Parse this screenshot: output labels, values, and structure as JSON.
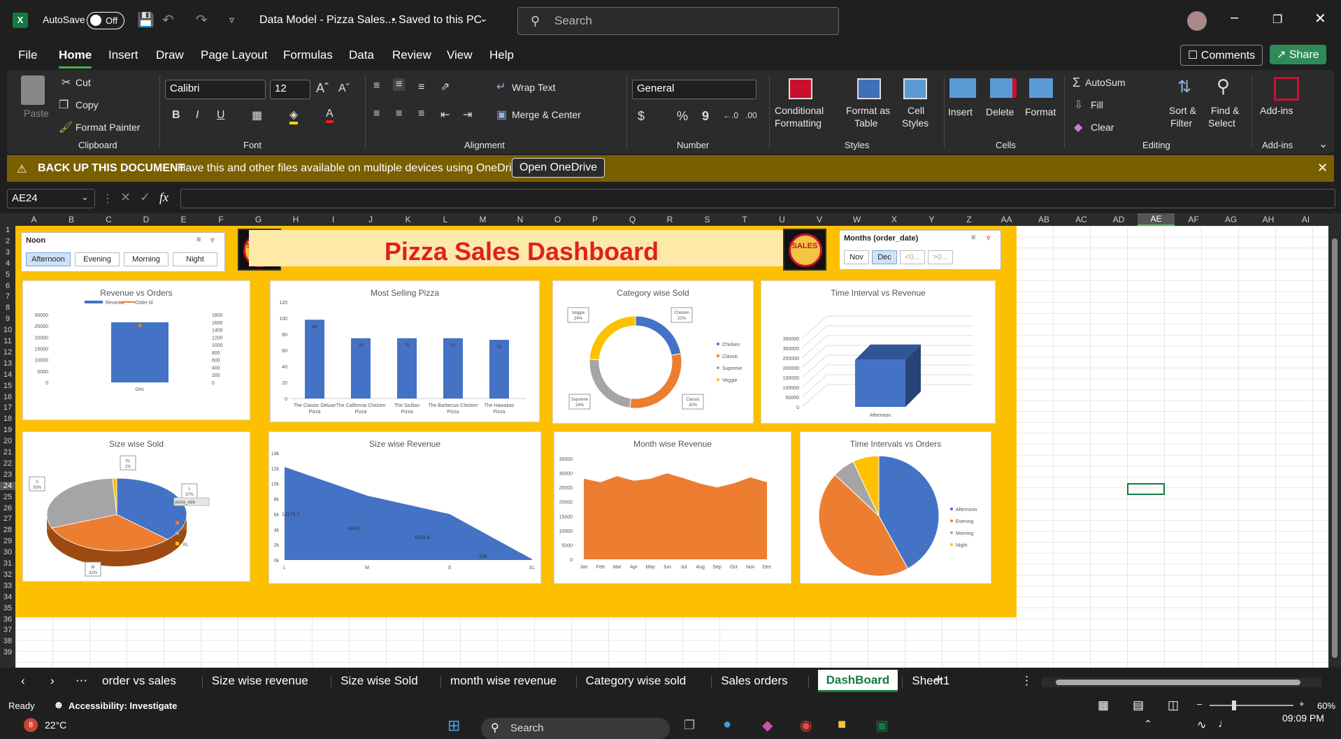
{
  "app": {
    "logo": "X",
    "autosave_label": "AutoSave",
    "toggle": "Off",
    "doc_title": "Data Model - Pizza Sales....",
    "saved": "• Saved to this PC",
    "search_placeholder": "Search"
  },
  "menu": [
    "File",
    "Home",
    "Insert",
    "Draw",
    "Page Layout",
    "Formulas",
    "Data",
    "Review",
    "View",
    "Help"
  ],
  "menu_right": {
    "comments": "Comments",
    "share": "Share"
  },
  "ribbon": {
    "clipboard": {
      "paste": "Paste",
      "cut": "Cut",
      "copy": "Copy",
      "format_painter": "Format Painter",
      "label": "Clipboard"
    },
    "font": {
      "name": "Calibri",
      "size": "12",
      "bold": "B",
      "italic": "I",
      "underline": "U",
      "label": "Font"
    },
    "alignment": {
      "wrap": "Wrap Text",
      "merge": "Merge & Center",
      "label": "Alignment"
    },
    "number": {
      "format": "General",
      "currency": "$",
      "percent": "%",
      "comma": "9",
      "label": "Number"
    },
    "styles": {
      "conditional": "Conditional",
      "conditional2": "Formatting",
      "format_table": "Format as",
      "format_table2": "Table",
      "cell_styles": "Cell",
      "cell_styles2": "Styles",
      "label": "Styles"
    },
    "cells": {
      "insert": "Insert",
      "delete": "Delete",
      "format": "Format",
      "label": "Cells"
    },
    "editing": {
      "autosum": "AutoSum",
      "fill": "Fill",
      "clear": "Clear",
      "sort": "Sort &",
      "sort2": "Filter",
      "find": "Find &",
      "find2": "Select",
      "label": "Editing"
    },
    "addins": {
      "addins": "Add-ins",
      "label": "Add-ins"
    }
  },
  "notification": {
    "title": "BACK UP THIS DOCUMENT",
    "text": "Have this and other files available on multiple devices using OneDrive.",
    "button": "Open OneDrive"
  },
  "formula_bar": {
    "name_box": "AE24",
    "fx": "fx"
  },
  "columns": [
    "A",
    "B",
    "C",
    "D",
    "E",
    "F",
    "G",
    "H",
    "I",
    "J",
    "K",
    "L",
    "M",
    "N",
    "O",
    "P",
    "Q",
    "R",
    "S",
    "T",
    "U",
    "V",
    "W",
    "X",
    "Y",
    "Z",
    "AA",
    "AB",
    "AC",
    "AD",
    "AE",
    "AF",
    "AG",
    "AH",
    "AI"
  ],
  "dashboard": {
    "title": "Pizza Sales Dashboard",
    "logo_text": "SALES",
    "slicer_time": {
      "header": "Noon",
      "items": [
        "Afternoon",
        "Evening",
        "Morning",
        "Night"
      ],
      "selected": "Afternoon"
    },
    "slicer_months": {
      "header": "Months (order_date)",
      "items": [
        "Nov",
        "Dec",
        "<0...",
        ">0..."
      ],
      "selected": "Dec"
    }
  },
  "chart_data": [
    {
      "type": "bar",
      "title": "Revenue vs Orders",
      "categories": [
        "Dec"
      ],
      "series": [
        {
          "name": "Revenue",
          "values": [
            26600
          ],
          "axis": "left"
        },
        {
          "name": "Order id",
          "values": [
            1510
          ],
          "axis": "right",
          "type": "line"
        }
      ],
      "ylim": [
        0,
        30000
      ],
      "y2lim": [
        0,
        1800
      ],
      "yticks": [
        "0",
        "5000",
        "10000",
        "15000",
        "20000",
        "25000",
        "30000"
      ],
      "y2ticks": [
        "0",
        "200",
        "400",
        "600",
        "800",
        "1000",
        "1200",
        "1400",
        "1600",
        "1800"
      ],
      "colors": [
        "#4472c4",
        "#ed7d31"
      ]
    },
    {
      "type": "bar",
      "title": "Most Selling Pizza",
      "categories": [
        "The Classic Deluxe Pizza",
        "The California Chicken Pizza",
        "The Sicilian Pizza",
        "The Barbecue Chicken Pizza",
        "The Hawaiian Pizza"
      ],
      "values": [
        98,
        75,
        75,
        75,
        73
      ],
      "data_labels": [
        "98",
        "75",
        "75",
        "75",
        "73"
      ],
      "ylim": [
        0,
        120
      ],
      "yticks": [
        "0",
        "20",
        "40",
        "60",
        "80",
        "100",
        "120"
      ],
      "color": "#4472c4"
    },
    {
      "type": "pie",
      "title": "Category wise Sold",
      "labels": [
        "Chicken",
        "Classic",
        "Supreme",
        "Veggie"
      ],
      "values": [
        22,
        30,
        24,
        24
      ],
      "data_labels": [
        "Chicken\n22%",
        "Classic\n30%",
        "Supreme\n24%",
        "Veggie\n24%"
      ],
      "colors": [
        "#4472c4",
        "#ed7d31",
        "#a5a5a5",
        "#ffc000"
      ],
      "donut": true
    },
    {
      "type": "bar",
      "title": "Time Interval vs Revenue",
      "categories": [
        "Afternoon"
      ],
      "values": [
        240000
      ],
      "ylim": [
        0,
        350000
      ],
      "yticks": [
        "0",
        "50000",
        "100000",
        "150000",
        "200000",
        "250000",
        "300000",
        "350000"
      ],
      "color": "#4472c4"
    },
    {
      "type": "pie",
      "title": "Size wise Sold",
      "labels": [
        "L",
        "M",
        "S",
        "XL"
      ],
      "values": [
        37,
        32,
        30,
        1
      ],
      "data_labels": [
        "L\n37%",
        "M\n32%",
        "S\n30%",
        "XL\n1%"
      ],
      "colors": [
        "#4472c4",
        "#ed7d31",
        "#a5a5a5",
        "#ffc000"
      ],
      "legend_title": "pizza_size"
    },
    {
      "type": "area",
      "title": "Size wise Revenue",
      "categories": [
        "L",
        "M",
        "S",
        "XL"
      ],
      "values": [
        12176.7,
        8431,
        6010.8,
        118
      ],
      "data_labels": [
        "12176.7",
        "8431",
        "6010.8",
        "118"
      ],
      "ylim": [
        0,
        14000
      ],
      "yticks": [
        "0k",
        "2k",
        "4k",
        "6k",
        "8k",
        "10k",
        "12k",
        "14k"
      ],
      "color": "#4472c4"
    },
    {
      "type": "area",
      "title": "Month wise Revenue",
      "categories": [
        "Jan",
        "Feb",
        "Mar",
        "Apr",
        "May",
        "Jun",
        "Jul",
        "Aug",
        "Sep",
        "Oct",
        "Nov",
        "Dec"
      ],
      "values": [
        28000,
        26800,
        28900,
        27300,
        28000,
        29900,
        28200,
        26300,
        25000,
        26400,
        28500,
        26800
      ],
      "ylim": [
        0,
        35000
      ],
      "yticks": [
        "0",
        "5000",
        "10000",
        "15000",
        "20000",
        "25000",
        "30000",
        "35000"
      ],
      "color": "#ed7d31"
    },
    {
      "type": "pie",
      "title": "Time Intervals vs Orders",
      "labels": [
        "Afternoon",
        "Evening",
        "Morning",
        "Night"
      ],
      "values": [
        42,
        45,
        6,
        7
      ],
      "colors": [
        "#4472c4",
        "#ed7d31",
        "#a5a5a5",
        "#ffc000"
      ]
    }
  ],
  "sheets": [
    "order vs sales",
    "Size wise revenue",
    "Size wise Sold",
    "month wise revenue",
    "Category wise sold",
    "Sales orders",
    "DashBoard",
    "Sheet1"
  ],
  "active_sheet": "DashBoard",
  "status": {
    "ready": "Ready",
    "accessibility": "Accessibility: Investigate",
    "zoom": "60%"
  },
  "taskbar": {
    "weather": "22°C",
    "badge": "8",
    "search": "Search",
    "time": "09:09 PM"
  }
}
